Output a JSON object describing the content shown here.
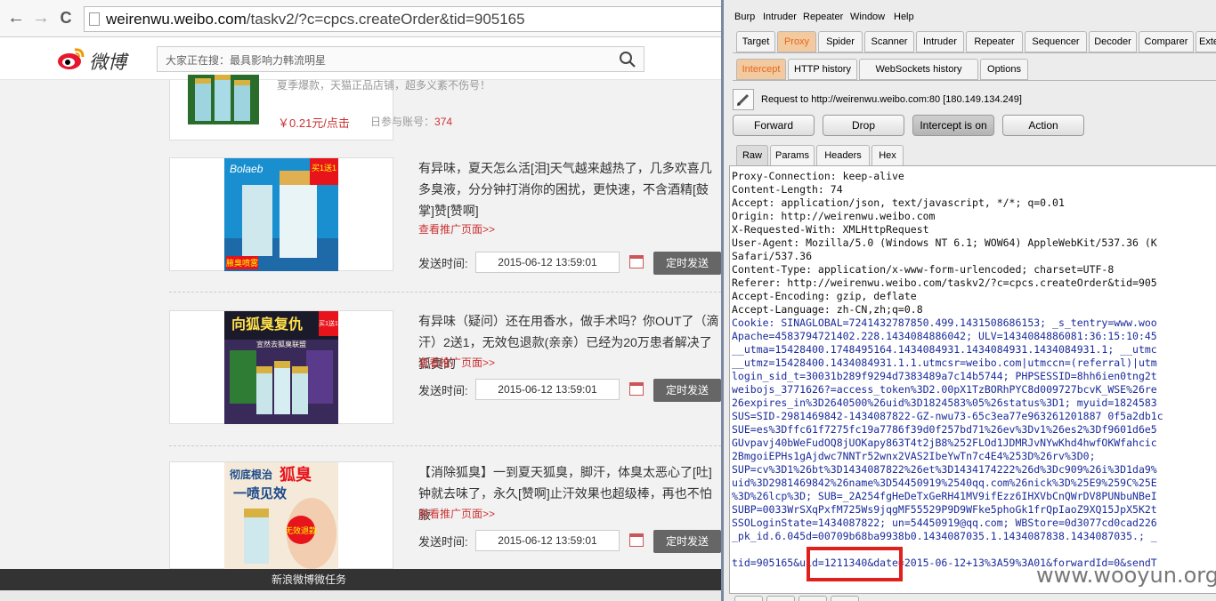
{
  "browser": {
    "url_prefix": "weirenwu.weibo.com",
    "url_path": "/taskv2/?c=cpcs.createOrder&tid=905165",
    "back_glyph": "←",
    "forward_glyph": "→",
    "reload_glyph": "C"
  },
  "weibo": {
    "logo_text": "微博",
    "search_placeholder": "大家正在搜：最具影响力韩流明星"
  },
  "partial_item": {
    "desc": "夏季爆款，天猫正品店铺，超多义紊不伤号！",
    "price": "￥0.21元/点击",
    "count_label": "日参与账号：",
    "count_value": "374"
  },
  "ads": [
    {
      "text": "有异味，夏天怎么活[泪]天气越来越热了，几多欢喜几多臭液，分分钟打消你的困扰，更快速，不含酒精[鼓掌]赞[赞啊]",
      "more": "查看推广页面>>",
      "time_label": "发送时间:",
      "time_value": "2015-06-12 13:59:01",
      "send_label": "定时发送",
      "pic_badge": "买1送1",
      "pic_brand": "Bolaeb",
      "pic_label": "腋臭喷雾"
    },
    {
      "text": "有异味（疑问）还在用香水，做手术吗？你OUT了（滴汗）2送1，无效包退款(亲亲）已经为20万患者解决了狐臭的",
      "more": "查看推广页面>>",
      "time_label": "发送时间:",
      "time_value": "2015-06-12 13:59:01",
      "send_label": "定时发送",
      "pic_badge": "买1送1",
      "pic_headline": "向狐臭复仇",
      "pic_sub": "宣然去狐臭联盟"
    },
    {
      "text": "【消除狐臭】一到夏天狐臭，脚汗，体臭太恶心了[吐]钟就去味了，永久[赞啊]止汗效果也超级棒，再也不怕腋",
      "more": "查看推广页面>>",
      "time_label": "发送时间:",
      "time_value": "2015-06-12 13:59:01",
      "send_label": "定时发送",
      "pic_headline1": "彻底根治",
      "pic_headline2": "狐臭",
      "pic_headline3": "一喷见效",
      "pic_badge": "无效退款"
    }
  ],
  "taskbar_title": "新浪微博微任务",
  "burp": {
    "menu": [
      "Burp",
      "Intruder",
      "Repeater",
      "Window",
      "Help"
    ],
    "main_tabs": [
      "Target",
      "Proxy",
      "Spider",
      "Scanner",
      "Intruder",
      "Repeater",
      "Sequencer",
      "Decoder",
      "Comparer",
      "Exten"
    ],
    "sub_tabs": [
      "Intercept",
      "HTTP history",
      "WebSockets history",
      "Options"
    ],
    "request_info": "Request to http://weirenwu.weibo.com:80  [180.149.134.249]",
    "buttons": [
      "Forward",
      "Drop",
      "Intercept is on",
      "Action"
    ],
    "view_tabs": [
      "Raw",
      "Params",
      "Headers",
      "Hex"
    ],
    "lines": [
      "Proxy-Connection: keep-alive",
      "Content-Length: 74",
      "Accept: application/json, text/javascript, */*; q=0.01",
      "Origin: http://weirenwu.weibo.com",
      "X-Requested-With: XMLHttpRequest",
      "User-Agent: Mozilla/5.0 (Windows NT 6.1; WOW64) AppleWebKit/537.36 (K",
      "Safari/537.36",
      "Content-Type: application/x-www-form-urlencoded; charset=UTF-8",
      "Referer: http://weirenwu.weibo.com/taskv2/?c=cpcs.createOrder&tid=905",
      "Accept-Encoding: gzip, deflate",
      "Accept-Language: zh-CN,zh;q=0.8"
    ],
    "cookie_lines": [
      "Cookie: SINAGLOBAL=7241432787850.499.1431508686153; _s_tentry=www.woo",
      "Apache=4583794721402.228.1434084886042; ULV=1434084886081:36:15:10:45",
      "__utma=15428400.1748495164.1434084931.1434084931.1434084931.1; __utmc",
      "__utmz=15428400.1434084931.1.1.utmcsr=weibo.com|utmccn=(referral)|utm",
      "login_sid_t=30031b289f9294d7383489a7c14b5744; PHPSESSID=8hh6ien0tng2t",
      "weibojs_3771626?=access_token%3D2.00pX1TzBORhPYC8d009727bcvK_WSE%26re",
      "26expires_in%3D2640500%26uid%3D1824583%05%26status%3D1; myuid=1824583",
      "SUS=SID-2981469842-1434087822-GZ-nwu73-65c3ea77e963261201887 0f5a2db1c",
      "SUE=es%3Dffc61f7275fc19a7786f39d0f257bd71%26ev%3Dv1%26es2%3Df9601d6e5",
      "GUvpavj40bWeFudOQ8jUOKapy863T4t2jB8%252FLOd1JDMRJvNYwKhd4hwfOKWfahcic",
      "2BmgoiEPHs1gAjdwc7NNTr52wnx2VAS2IbeYwTn7c4E4%253D%26rv%3D0;",
      "SUP=cv%3D1%26bt%3D1434087822%26et%3D1434174222%26d%3Dc909%26i%3D1da9%",
      "uid%3D2981469842%26name%3D54450919%2540qq.com%26nick%3D%25E9%259C%25E",
      "%3D%26lcp%3D; SUB=_2A254fgHeDeTxGeRH41MV9ifEzz6IHXVbCnQWrDV8PUNbuNBeI",
      "SUBP=0033WrSXqPxfM725Ws9jqgMF55529P9D9WFke5phoGk1frQpIaoZ9XQ15JpX5K2t",
      "SSOLoginState=1434087822; un=54450919@qq.com; WBStore=0d3077cd0cad226",
      "_pk_id.6.045d=00709b68ba9938b0.1434087035.1.1434087838.1434087035.; _"
    ],
    "body_line": "tid=905165&uid=1211340&date=2015-06-12+13%3A59%3A01&forwardId=0&sendT",
    "watermark": "www.wooyun.org"
  }
}
